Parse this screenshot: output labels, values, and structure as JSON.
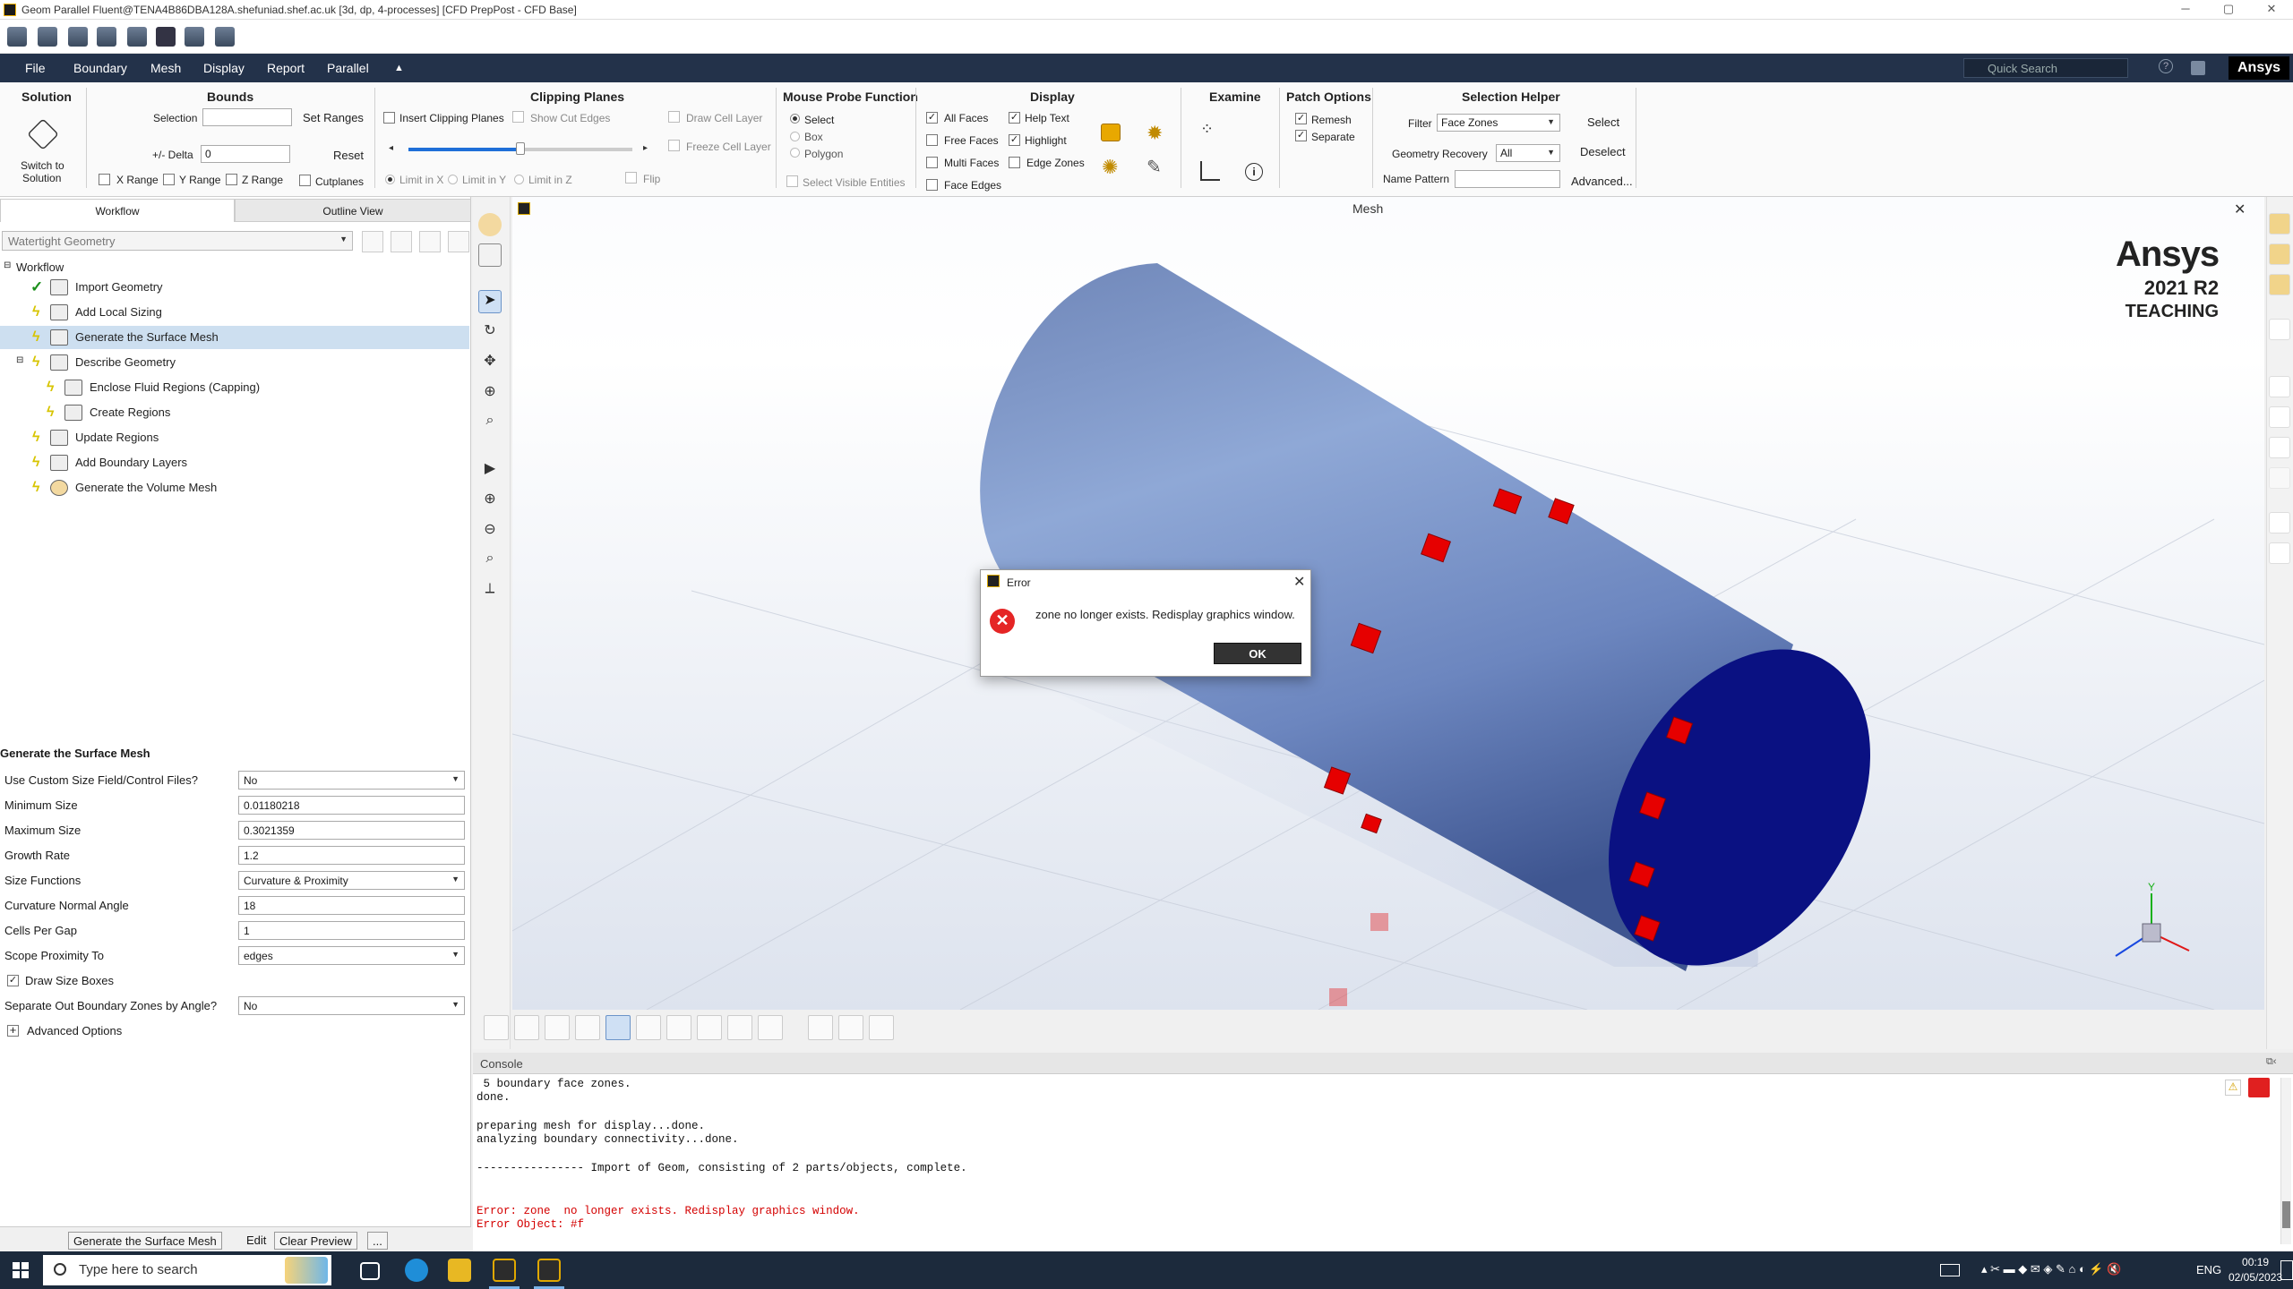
{
  "window": {
    "title": "Geom Parallel Fluent@TENA4B86DBA128A.shefuniad.shef.ac.uk  [3d, dp, 4-processes] [CFD PrepPost - CFD Base]",
    "minimize": "─",
    "maximize": "▢",
    "close": "✕"
  },
  "menubar": {
    "items": [
      "File",
      "Boundary",
      "Mesh",
      "Display",
      "Report",
      "Parallel"
    ],
    "collapse": "▲",
    "search_placeholder": "Quick Search",
    "help": "?",
    "brand": "Ansys"
  },
  "ribbon": {
    "solution": {
      "title": "Solution",
      "switch_label_1": "Switch to",
      "switch_label_2": "Solution"
    },
    "bounds": {
      "title": "Bounds",
      "selection_label": "Selection",
      "selection_value": "",
      "set_ranges": "Set Ranges",
      "delta_label": "+/- Delta",
      "delta_value": "0",
      "reset": "Reset",
      "x_range": "X Range",
      "y_range": "Y Range",
      "z_range": "Z Range",
      "cutplanes": "Cutplanes"
    },
    "clipping": {
      "title": "Clipping Planes",
      "insert": "Insert Clipping Planes",
      "show_cut_edges": "Show Cut Edges",
      "draw_cell_layer": "Draw Cell Layer",
      "freeze_cell_layer": "Freeze Cell Layer",
      "limit_x": "Limit in X",
      "limit_y": "Limit in Y",
      "limit_z": "Limit in Z",
      "flip": "Flip",
      "slider_fraction": 0.5
    },
    "probe": {
      "title": "Mouse Probe Function",
      "select": "Select",
      "box": "Box",
      "polygon": "Polygon",
      "select_visible": "Select Visible Entities"
    },
    "display": {
      "title": "Display",
      "all_faces": "All Faces",
      "free_faces": "Free Faces",
      "multi_faces": "Multi Faces",
      "face_edges": "Face Edges",
      "help_text": "Help Text",
      "highlight": "Highlight",
      "edge_zones": "Edge Zones"
    },
    "examine": {
      "title": "Examine"
    },
    "patch": {
      "title": "Patch Options",
      "remesh": "Remesh",
      "separate": "Separate"
    },
    "helper": {
      "title": "Selection Helper",
      "filter_label": "Filter",
      "filter_value": "Face Zones",
      "select": "Select",
      "geom_recovery_label": "Geometry Recovery",
      "geom_recovery_value": "All",
      "deselect": "Deselect",
      "name_pattern_label": "Name Pattern",
      "name_pattern_value": "",
      "advanced": "Advanced..."
    }
  },
  "left": {
    "tabs": [
      "Workflow",
      "Outline View"
    ],
    "workflow_select": "Watertight Geometry",
    "tree": [
      {
        "label": "Workflow",
        "status": ""
      },
      {
        "label": "Import Geometry",
        "status": "done"
      },
      {
        "label": "Add Local Sizing",
        "status": "pending"
      },
      {
        "label": "Generate the Surface Mesh",
        "status": "pending"
      },
      {
        "label": "Describe Geometry",
        "status": "pending"
      },
      {
        "label": "Enclose Fluid Regions (Capping)",
        "status": "pending"
      },
      {
        "label": "Create Regions",
        "status": "pending"
      },
      {
        "label": "Update Regions",
        "status": "pending"
      },
      {
        "label": "Add Boundary Layers",
        "status": "pending"
      },
      {
        "label": "Generate the Volume Mesh",
        "status": "pending"
      }
    ],
    "settings_title": "Generate the Surface Mesh",
    "settings": [
      {
        "label": "Use Custom Size Field/Control Files?",
        "value": "No"
      },
      {
        "label": "Minimum Size",
        "value": "0.01180218"
      },
      {
        "label": "Maximum Size",
        "value": "0.3021359"
      },
      {
        "label": "Growth Rate",
        "value": "1.2"
      },
      {
        "label": "Size Functions",
        "value": "Curvature & Proximity"
      },
      {
        "label": "Curvature Normal Angle",
        "value": "18"
      },
      {
        "label": "Cells Per Gap",
        "value": "1"
      },
      {
        "label": "Scope Proximity To",
        "value": "edges"
      },
      {
        "label": "Draw Size Boxes",
        "value": "✓"
      },
      {
        "label": "Separate Out Boundary Zones by Angle?",
        "value": "No"
      },
      {
        "label": "Advanced Options",
        "value": "+"
      }
    ],
    "bottom_buttons": [
      "Generate the Surface Mesh",
      "Edit",
      "Clear Preview",
      "..."
    ]
  },
  "graphics": {
    "title": "Mesh",
    "close": "✕",
    "brand_name": "Ansys",
    "brand_version": "2021 R2",
    "brand_edition": "TEACHING"
  },
  "dialog": {
    "title": "Error",
    "message": "zone  no longer exists. Redisplay graphics window.",
    "ok": "OK",
    "close": "✕"
  },
  "console": {
    "title": "Console",
    "lines": [
      {
        "text": " 5 boundary face zones.",
        "error": false
      },
      {
        "text": "done.",
        "error": false
      },
      {
        "text": "",
        "error": false
      },
      {
        "text": "preparing mesh for display...done.",
        "error": false
      },
      {
        "text": "analyzing boundary connectivity...done.",
        "error": false
      },
      {
        "text": "",
        "error": false
      },
      {
        "text": "---------------- Import of Geom, consisting of 2 parts/objects, complete.",
        "error": false
      },
      {
        "text": "",
        "error": false
      },
      {
        "text": "",
        "error": false
      },
      {
        "text": "Error: zone  no longer exists. Redisplay graphics window.",
        "error": true
      },
      {
        "text": "Error Object: #f",
        "error": true
      }
    ]
  },
  "taskbar": {
    "search_placeholder": "Type here to search",
    "lang": "ENG",
    "time": "00:19",
    "date": "02/05/2023"
  },
  "colors": {
    "menubar": "#23324a",
    "cylinder_body": "#7f99cc",
    "cylinder_cap": "#0a1182",
    "size_box": "#e60000",
    "error_red": "#d40000"
  }
}
